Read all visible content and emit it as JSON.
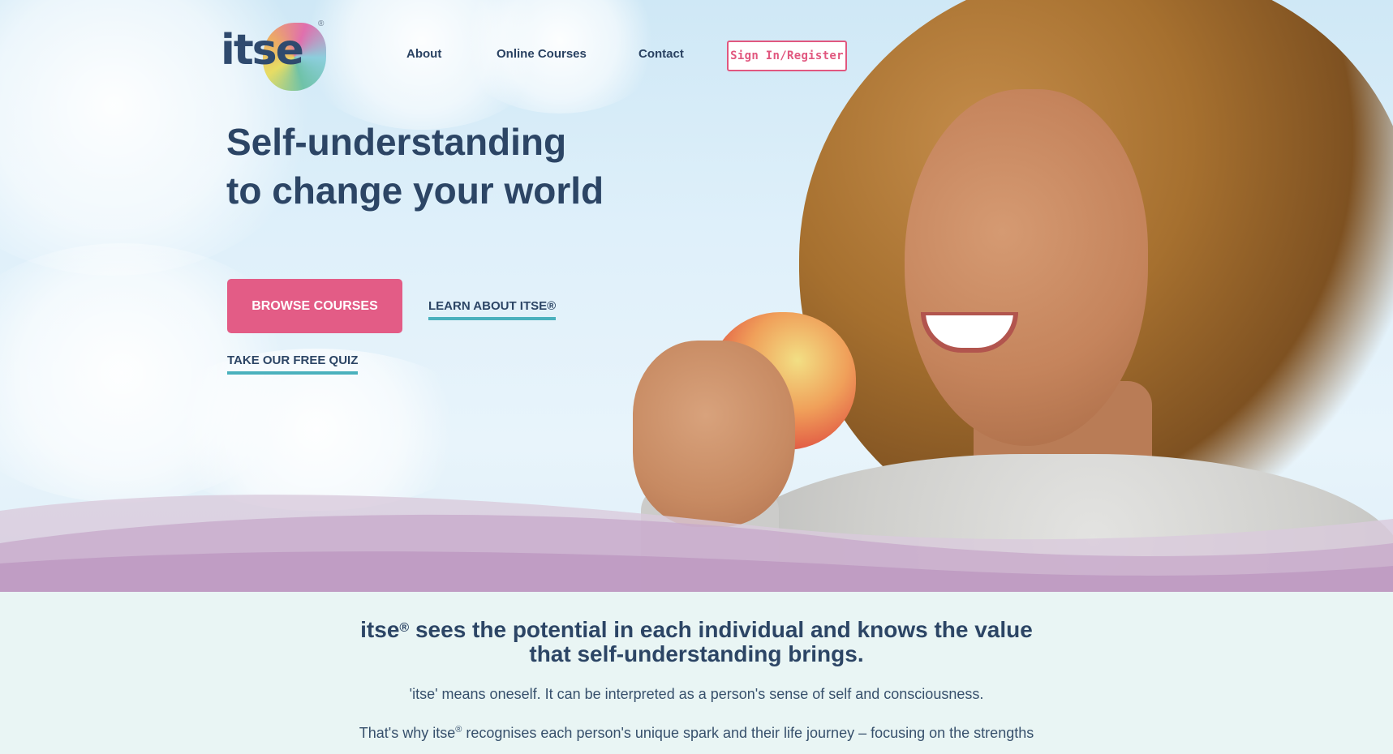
{
  "brand": {
    "logo_text": "itse",
    "logo_mark": "®"
  },
  "nav": {
    "items": [
      {
        "label": "About"
      },
      {
        "label": "Online Courses"
      },
      {
        "label": "Contact"
      }
    ],
    "signin_label": "Sign In/Register"
  },
  "hero": {
    "headline_line1": "Self-understanding",
    "headline_line2": "to change your world",
    "primary_cta": "BROWSE COURSES",
    "secondary_cta": "LEARN ABOUT ITSE®",
    "quiz_link": "TAKE OUR FREE QUIZ"
  },
  "intro": {
    "title_brand": "itse",
    "title_mark": "®",
    "title_rest_line1": " sees the potential in each individual and knows the value",
    "title_line2": "that self-understanding brings.",
    "paragraph1": "'itse' means oneself. It can be interpreted as a person's sense of self and consciousness.",
    "paragraph2_start": "That's why itse",
    "paragraph2_mark": "®",
    "paragraph2_end": " recognises each person's unique spark and their life journey – focusing on the strengths"
  },
  "colors": {
    "accent_pink": "#e35c86",
    "accent_teal": "#4ab1bd",
    "navy": "#2c4565",
    "section_bg": "#e9f5f4"
  }
}
